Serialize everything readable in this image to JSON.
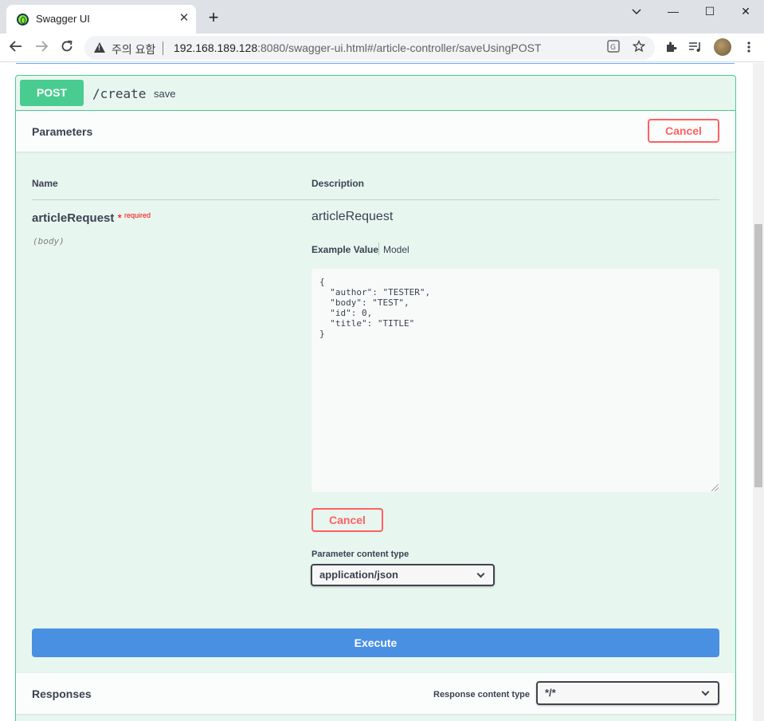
{
  "browser": {
    "tab_title": "Swagger UI",
    "tab_close": "✕",
    "new_tab": "+",
    "window_controls": {
      "minimize": "—",
      "maximize": "☐",
      "close": "✕"
    },
    "security_label": "주의 요함",
    "url_host": "192.168.189.128",
    "url_rest": ":8080/swagger-ui.html#/article-controller/saveUsingPOST",
    "icons": [
      "back-icon",
      "forward-icon",
      "reload-icon",
      "warning-icon",
      "translate-icon",
      "star-icon",
      "extensions-icon",
      "media-icon",
      "avatar",
      "menu-icon"
    ]
  },
  "operation": {
    "method": "POST",
    "path": "/create",
    "summary": "save",
    "method_color": "#49cc90",
    "background_color": "#e8f6f0"
  },
  "parameters": {
    "title": "Parameters",
    "cancel_label": "Cancel",
    "col_name": "Name",
    "col_description": "Description",
    "param": {
      "name": "articleRequest",
      "required_star": "*",
      "required_label": "required",
      "in": "(body)",
      "description": "articleRequest",
      "tab_example": "Example Value",
      "tab_model": "Model",
      "example_value": "{\n  \"author\": \"TESTER\",\n  \"body\": \"TEST\",\n  \"id\": 0,\n  \"title\": \"TITLE\"\n}",
      "cancel_label": "Cancel"
    },
    "content_type_label": "Parameter content type",
    "content_type_value": "application/json"
  },
  "execute": {
    "label": "Execute",
    "color": "#4990e2"
  },
  "responses": {
    "title": "Responses",
    "content_type_label": "Response content type",
    "content_type_value": "*/*"
  }
}
